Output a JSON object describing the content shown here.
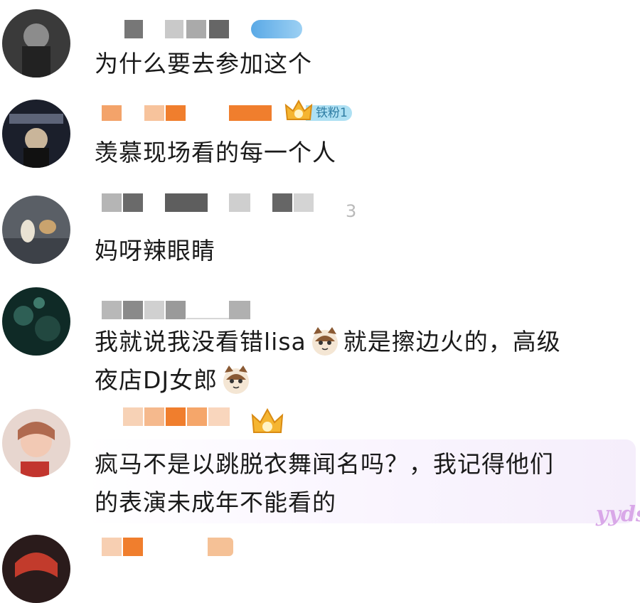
{
  "comments": [
    {
      "text": "为什么要去参加这个"
    },
    {
      "text": "羡慕现场看的每一个人",
      "badge": {
        "label": "铁粉1",
        "icon": "crown-icon"
      }
    },
    {
      "text": "妈呀辣眼睛"
    },
    {
      "line1_a": "我就说我没看错lisa",
      "line1_b": "就是擦边火的，高级",
      "line2": "夜店DJ女郎",
      "emoji": "cat-face-icon"
    },
    {
      "line1": "疯马不是以跳脱衣舞闻名吗？，我记得他们",
      "line2": "的表演未成年不能看的",
      "badge": {
        "icon": "crown-icon"
      }
    },
    {
      "text": ""
    }
  ],
  "watermark": "yyds",
  "colors": {
    "accent_orange": "#f07e2d",
    "accent_blue": "#5aa9e6",
    "badge_blue": "#aee0f3",
    "gray_block": "#6b6b6b",
    "light_gray_block": "#c8c8c8"
  }
}
